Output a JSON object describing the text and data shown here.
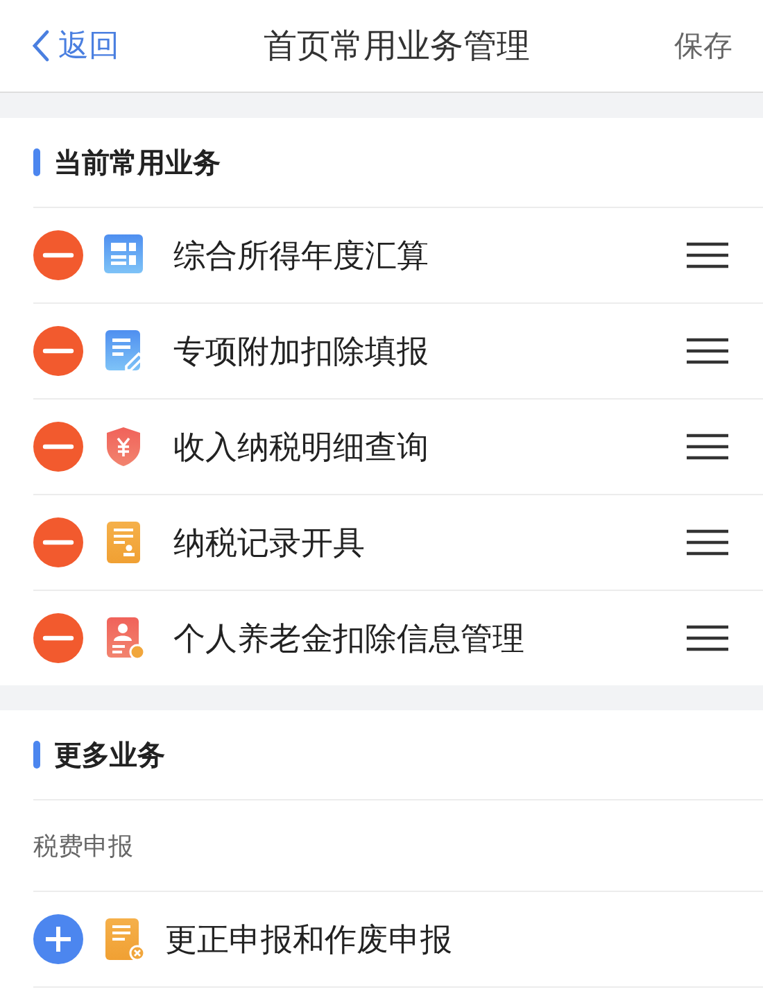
{
  "nav_bar": {
    "back": "返回",
    "title": "首页常用业务管理",
    "action": "保存"
  },
  "current": {
    "title": "当前常用业务",
    "items": [
      {
        "label": "综合所得年度汇算"
      },
      {
        "label": "专项附加扣除填报"
      },
      {
        "label": "收入纳税明细查询"
      },
      {
        "label": "纳税记录开具"
      },
      {
        "label": "个人养老金扣除信息管理"
      }
    ]
  },
  "more": {
    "title": "更多业务",
    "groups": [
      {
        "title": "税费申报",
        "items": [
          {
            "label": "更正申报和作废申报"
          }
        ]
      }
    ]
  }
}
